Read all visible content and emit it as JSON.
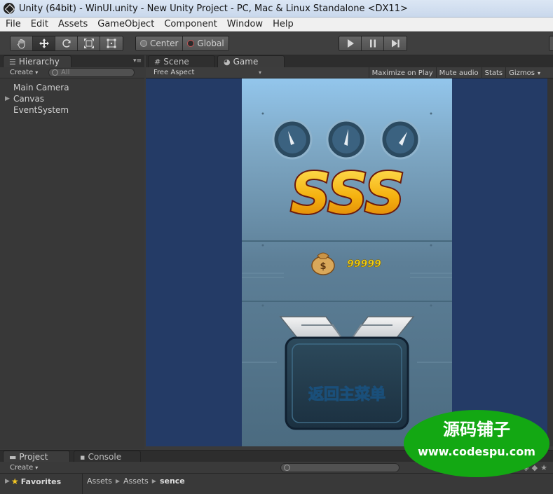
{
  "window": {
    "title": "Unity (64bit) - WinUI.unity - New Unity Project - PC, Mac & Linux Standalone <DX11>"
  },
  "menubar": {
    "items": [
      "File",
      "Edit",
      "Assets",
      "GameObject",
      "Component",
      "Window",
      "Help"
    ]
  },
  "toolbar": {
    "transform_tools": [
      "hand-icon",
      "move-icon",
      "rotate-icon",
      "scale-icon",
      "rect-icon"
    ],
    "active_tool": "move-icon",
    "pivot_label": "Center",
    "space_label": "Global",
    "play_controls": [
      "play-icon",
      "pause-icon",
      "step-icon"
    ]
  },
  "hierarchy": {
    "tab_label": "Hierarchy",
    "create_label": "Create",
    "search_placeholder": "All",
    "items": [
      {
        "name": "Main Camera",
        "expandable": false
      },
      {
        "name": "Canvas",
        "expandable": true
      },
      {
        "name": "EventSystem",
        "expandable": false
      }
    ]
  },
  "game_panel": {
    "tabs": [
      {
        "label": "Scene",
        "active": false
      },
      {
        "label": "Game",
        "active": true
      }
    ],
    "aspect_label": "Free Aspect",
    "options": [
      "Maximize on Play",
      "Mute audio",
      "Stats",
      "Gizmos"
    ],
    "game": {
      "gauges": [
        "gauge-icon",
        "gauge-icon",
        "gauge-icon"
      ],
      "rating_text": "SSS",
      "coins_value": "99999",
      "button_label": "返回主菜单",
      "colors": {
        "sky_top": "#8fc3ea",
        "panel_bg": "#5b7c93",
        "rating_gold": "#f7c21a",
        "rating_outline": "#6b1a0c",
        "coin_text": "#f2d31b",
        "button_text": "#cfe8ff"
      }
    }
  },
  "project": {
    "tabs": [
      {
        "label": "Project",
        "active": true
      },
      {
        "label": "Console",
        "active": false
      }
    ],
    "create_label": "Create",
    "favorites_label": "Favorites",
    "breadcrumb": [
      "Assets",
      "Assets",
      "sence"
    ]
  },
  "watermark": {
    "line1": "源码铺子",
    "line2": "www.codespu.com",
    "color": "#13a813"
  }
}
